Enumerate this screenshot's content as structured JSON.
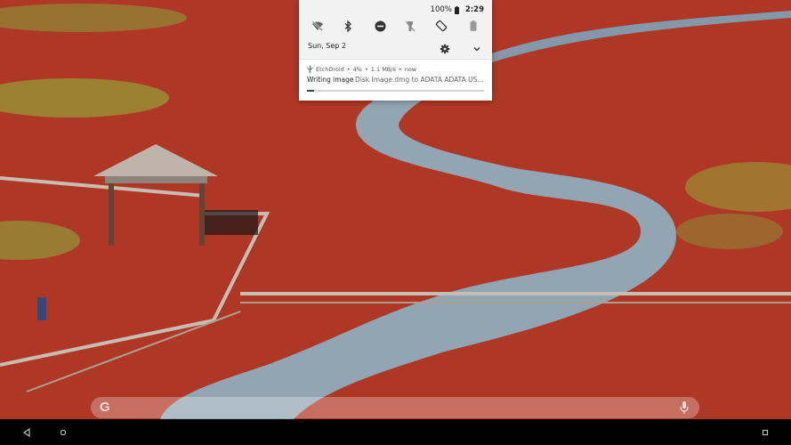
{
  "status_bar": {
    "battery": "100%",
    "time": "2:29"
  },
  "quick_settings": {
    "tiles": [
      {
        "name": "wifi-off"
      },
      {
        "name": "bluetooth"
      },
      {
        "name": "do-not-disturb"
      },
      {
        "name": "flashlight"
      },
      {
        "name": "auto-rotate"
      },
      {
        "name": "battery-saver"
      }
    ],
    "date": "Sun, Sep 2"
  },
  "notification": {
    "app_name": "EtchDroid",
    "percent": "4%",
    "speed": "1.1 MB/s",
    "when": "now",
    "separator": "•",
    "title": "Writing image",
    "text": "Disk Image.dmg to ADATA ADATA USB Flash Drive",
    "progress": 0.04
  },
  "search_bar": {
    "logo": "G"
  },
  "colors": {
    "shade_bg": "#f2f2f2",
    "progress_fill": "#444444",
    "navbar_bg": "#000000"
  }
}
